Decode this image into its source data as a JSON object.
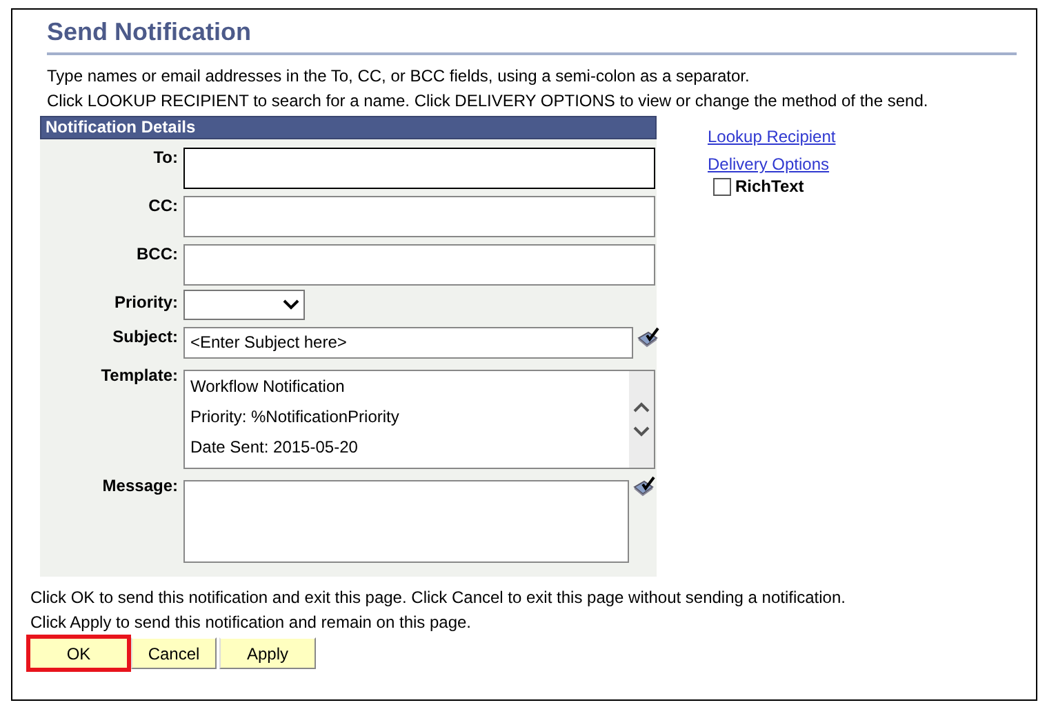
{
  "page": {
    "title": "Send Notification",
    "instructions": [
      "Type names or email addresses in the To, CC, or BCC fields, using a semi-colon as a separator.",
      "Click LOOKUP RECIPIENT to search for a name.  Click DELIVERY OPTIONS to view or change the method of the send."
    ]
  },
  "details": {
    "header": "Notification Details",
    "fields": [
      {
        "kind": "address",
        "label": "To:",
        "focused": true
      },
      {
        "kind": "address",
        "label": "CC:",
        "focused": false
      },
      {
        "kind": "address",
        "label": "BCC:",
        "focused": false
      },
      {
        "kind": "select",
        "label": "Priority:"
      },
      {
        "kind": "text",
        "label": "Subject:",
        "value": "<Enter Subject here>"
      },
      {
        "kind": "scrolltext",
        "label": "Template:",
        "lines": [
          "Workflow Notification",
          "Priority:  %NotificationPriority",
          "Date Sent: 2015-05-20"
        ]
      },
      {
        "kind": "message",
        "label": "Message:"
      }
    ]
  },
  "links": [
    "Lookup Recipient",
    "Delivery Options"
  ],
  "richtext": {
    "label": "RichText",
    "checked": false
  },
  "notes": [
    "Click OK to send this notification and exit this page.  Click Cancel to exit this page without sending a notification.",
    "Click Apply to send this notification and remain on this page."
  ],
  "buttons": [
    {
      "label": "OK",
      "highlighted": true
    },
    {
      "label": "Cancel",
      "highlighted": false
    },
    {
      "label": "Apply",
      "highlighted": false
    }
  ]
}
